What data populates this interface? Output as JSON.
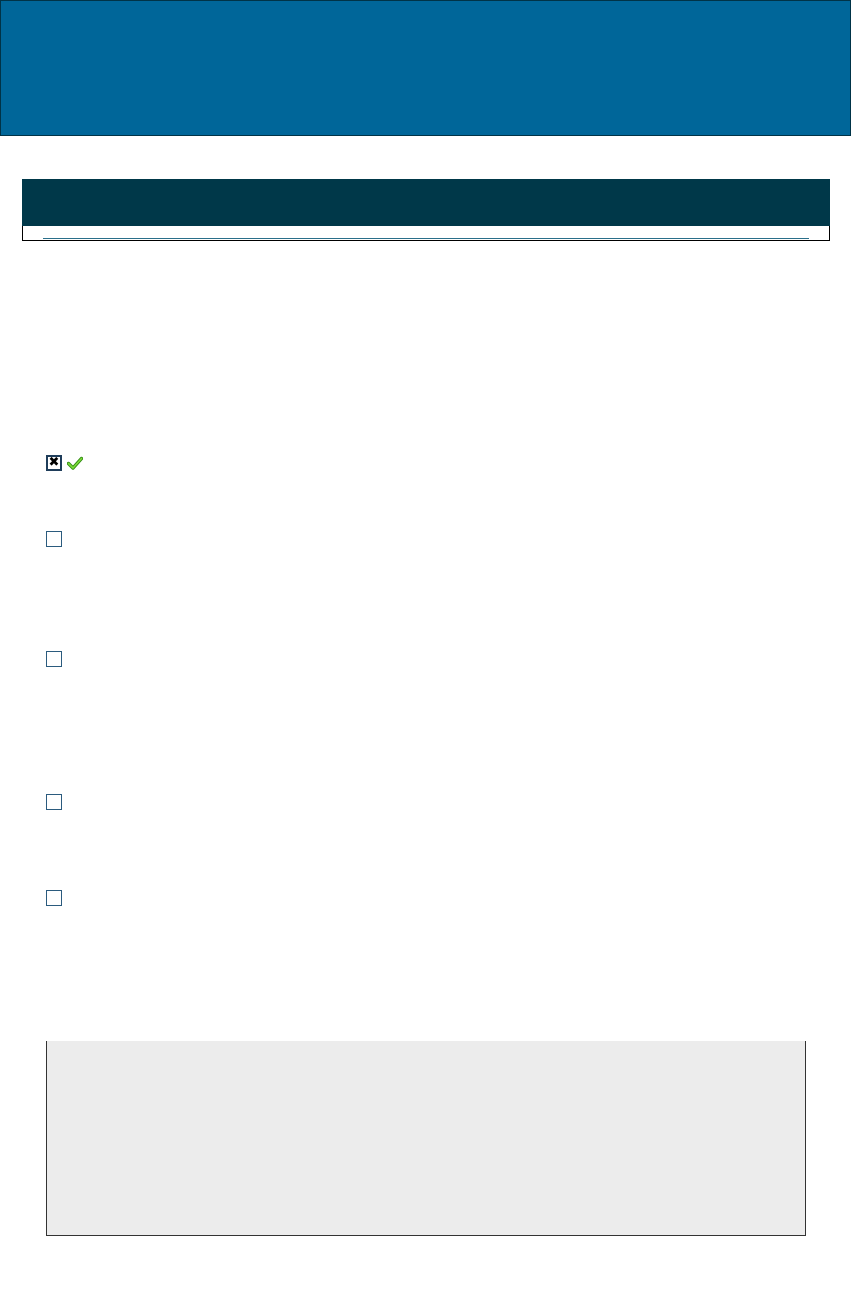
{
  "options": [
    {
      "checked": true,
      "correct": true
    },
    {
      "checked": false
    },
    {
      "checked": false
    },
    {
      "checked": false
    },
    {
      "checked": false
    }
  ],
  "icons": {
    "check": "check-icon",
    "x_mark": "✖"
  },
  "colors": {
    "banner": "#006699",
    "header": "#003849",
    "feedback_bg": "#ececec",
    "check_green": "#4caf1a"
  }
}
